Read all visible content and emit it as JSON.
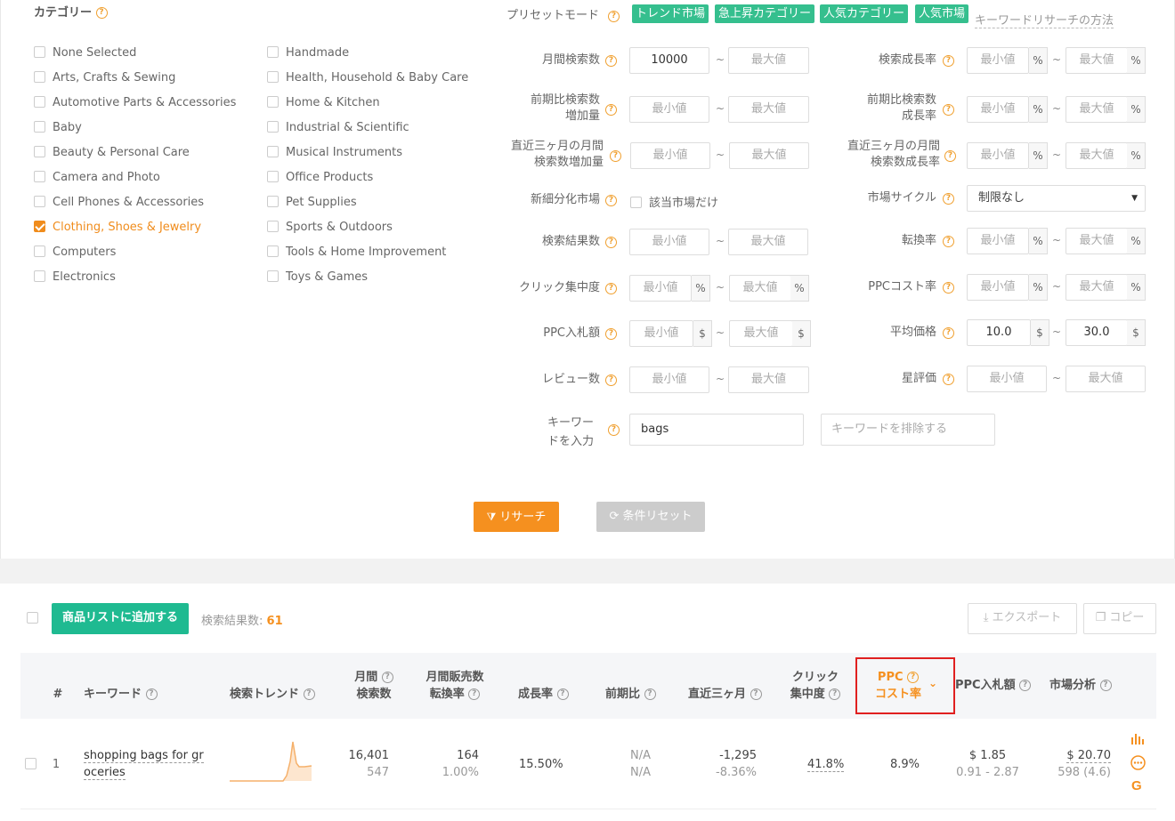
{
  "category": {
    "title": "カテゴリー",
    "col1": [
      {
        "label": "None Selected",
        "checked": false
      },
      {
        "label": "Arts, Crafts & Sewing",
        "checked": false
      },
      {
        "label": "Automotive Parts & Accessories",
        "checked": false
      },
      {
        "label": "Baby",
        "checked": false
      },
      {
        "label": "Beauty & Personal Care",
        "checked": false
      },
      {
        "label": "Camera and Photo",
        "checked": false
      },
      {
        "label": "Cell Phones & Accessories",
        "checked": false
      },
      {
        "label": "Clothing, Shoes & Jewelry",
        "checked": true
      },
      {
        "label": "Computers",
        "checked": false
      },
      {
        "label": "Electronics",
        "checked": false
      }
    ],
    "col2": [
      {
        "label": "Handmade",
        "checked": false
      },
      {
        "label": "Health, Household & Baby Care",
        "checked": false
      },
      {
        "label": "Home & Kitchen",
        "checked": false
      },
      {
        "label": "Industrial & Scientific",
        "checked": false
      },
      {
        "label": "Musical Instruments",
        "checked": false
      },
      {
        "label": "Office Products",
        "checked": false
      },
      {
        "label": "Pet Supplies",
        "checked": false
      },
      {
        "label": "Sports & Outdoors",
        "checked": false
      },
      {
        "label": "Tools & Home Improvement",
        "checked": false
      },
      {
        "label": "Toys & Games",
        "checked": false
      }
    ]
  },
  "preset": {
    "label": "プリセットモード",
    "tags": [
      "トレンド市場",
      "急上昇カテゴリー",
      "人気カテゴリー",
      "人気市場"
    ],
    "help_link": "キーワードリサーチの方法"
  },
  "filters": {
    "min": "最小値",
    "max": "最大値",
    "tilde": "~",
    "pct": "%",
    "usd": "$",
    "monthly_search": {
      "label": "月間検索数",
      "min_value": "10000"
    },
    "search_growth": {
      "label": "検索成長率"
    },
    "prev_search_inc": {
      "label1": "前期比検索数",
      "label2": "増加量"
    },
    "prev_search_growth": {
      "label1": "前期比検索数",
      "label2": "成長率"
    },
    "q3_search_inc": {
      "label1": "直近三ヶ月の月間",
      "label2": "検索数増加量"
    },
    "q3_search_growth": {
      "label1": "直近三ヶ月の月間",
      "label2": "検索数成長率"
    },
    "new_market": {
      "label": "新細分化市場",
      "checkbox": "該当市場だけ"
    },
    "market_cycle": {
      "label": "市場サイクル",
      "value": "制限なし"
    },
    "result_count": {
      "label": "検索結果数"
    },
    "conversion": {
      "label": "転換率"
    },
    "click_conc": {
      "label": "クリック集中度"
    },
    "ppc_cost": {
      "label": "PPCコスト率"
    },
    "ppc_bid": {
      "label": "PPC入札額"
    },
    "avg_price": {
      "label": "平均価格",
      "min_value": "10.0",
      "max_value": "30.0"
    },
    "review_count": {
      "label": "レビュー数"
    },
    "star_rating": {
      "label": "星評価"
    },
    "keyword": {
      "label1": "キーワー",
      "label2": "ドを入力",
      "value": "bags",
      "exclude_placeholder": "キーワードを排除する"
    }
  },
  "actions": {
    "research": "リサーチ",
    "reset": "条件リセット"
  },
  "results": {
    "add_button": "商品リストに追加する",
    "count_label": "検索結果数:",
    "count": "61",
    "export": "エクスポート",
    "copy": "コピー"
  },
  "table": {
    "headers": {
      "num": "#",
      "keyword": "キーワード",
      "trend": "検索トレンド",
      "monthly1": "月間",
      "monthly2": "検索数",
      "sales1": "月間販売数",
      "sales2": "転換率",
      "growth": "成長率",
      "prev": "前期比",
      "q3": "直近三ヶ月",
      "click1": "クリック",
      "click2": "集中度",
      "ppc1": "PPC",
      "ppc2": "コスト率",
      "bid": "PPC入札額",
      "market": "市場分析"
    },
    "rows": [
      {
        "num": "1",
        "keyword_line1": "shopping bags for gr",
        "keyword_line2": "oceries",
        "monthly": "16,401",
        "monthly_sub": "547",
        "sales": "164",
        "conv": "1.00%",
        "growth": "15.50%",
        "prev1": "N/A",
        "prev2": "N/A",
        "q3_1": "-1,295",
        "q3_2": "-8.36%",
        "click": "41.8%",
        "ppc": "8.9%",
        "bid": "$ 1.85",
        "bid_range": "0.91 - 2.87",
        "price": "$ 20.70",
        "price_sub": "598 (4.6)"
      }
    ]
  },
  "colors": {
    "accent": "#f5901f",
    "green": "#1fba91",
    "tag": "#35bf8e",
    "highlight": "#e02020"
  }
}
